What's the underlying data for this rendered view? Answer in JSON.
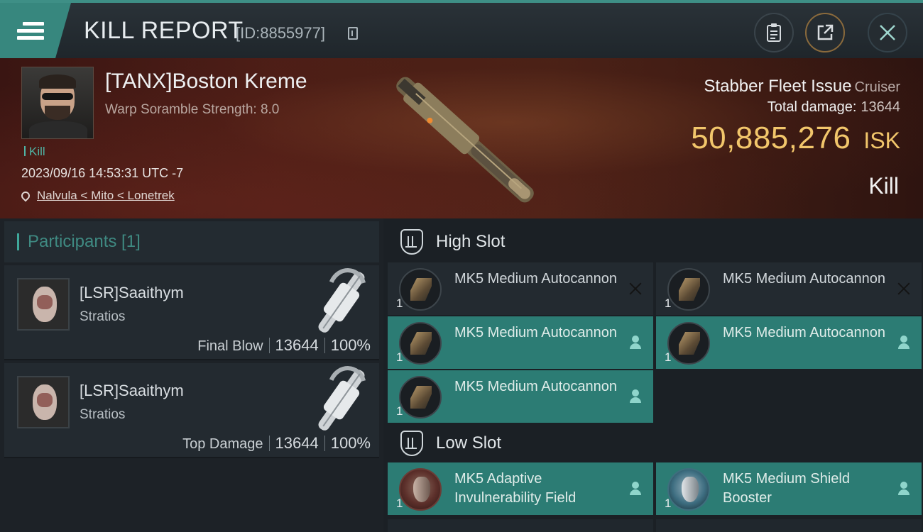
{
  "header": {
    "title": "KILL REPORT",
    "report_id": "[ID:8855977]"
  },
  "victim": {
    "name": "[TANX]Boston Kreme",
    "warp_scramble": "Warp Soramble Strength: 8.0",
    "kill_tag": "Kill",
    "datetime": "2023/09/16 14:53:31 UTC -7",
    "location": "Nalvula < Mito < Lonetrek",
    "ship_name": "Stabber Fleet Issue",
    "ship_class": "Cruiser",
    "total_damage_label": "Total damage:",
    "total_damage": "13644",
    "isk_value": "50,885,276",
    "isk_unit": "ISK",
    "result": "Kill"
  },
  "participants": {
    "header": "Participants [1]",
    "rows": [
      {
        "name": "[LSR]Saaithym",
        "ship": "Stratios",
        "role": "Final Blow",
        "damage": "13644",
        "percent": "100%"
      },
      {
        "name": "[LSR]Saaithym",
        "ship": "Stratios",
        "role": "Top Damage",
        "damage": "13644",
        "percent": "100%"
      }
    ]
  },
  "fitting": {
    "high_slot": {
      "label": "High Slot",
      "modules": [
        {
          "name": "MK5 Medium Autocannon",
          "qty": "1",
          "status": "destroyed",
          "icon": "autocannon-icon"
        },
        {
          "name": "MK5 Medium Autocannon",
          "qty": "1",
          "status": "destroyed",
          "icon": "autocannon-icon"
        },
        {
          "name": "MK5 Medium Autocannon",
          "qty": "1",
          "status": "dropped",
          "icon": "autocannon-icon"
        },
        {
          "name": "MK5 Medium Autocannon",
          "qty": "1",
          "status": "dropped",
          "icon": "autocannon-icon"
        },
        {
          "name": "MK5 Medium Autocannon",
          "qty": "1",
          "status": "dropped",
          "icon": "autocannon-icon"
        }
      ]
    },
    "low_slot": {
      "label": "Low Slot",
      "modules": [
        {
          "name": "MK5 Adaptive Invulnerability Field",
          "qty": "1",
          "status": "dropped",
          "icon": "invulnerability-field-icon"
        },
        {
          "name": "MK5 Medium Shield Booster",
          "qty": "1",
          "status": "dropped",
          "icon": "shield-booster-icon"
        }
      ]
    }
  },
  "colors": {
    "accent_teal": "#2c7c74",
    "isk_gold": "#f2c66b",
    "banner_red": "#4d1e17"
  }
}
